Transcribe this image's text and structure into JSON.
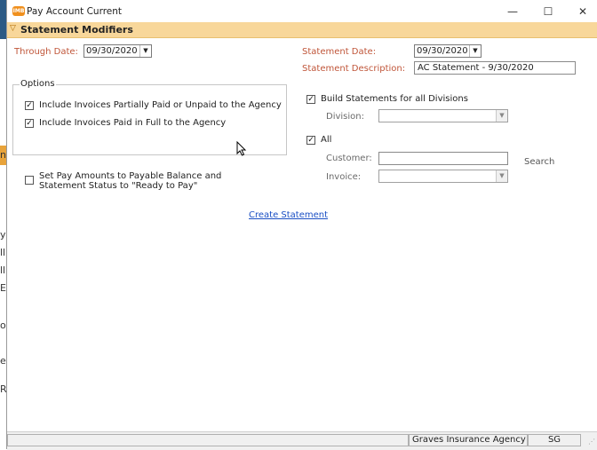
{
  "window": {
    "title": "Pay Account Current",
    "icon": "app-logo-icon",
    "icon_text": "IMB",
    "minimize_symbol": "—",
    "maximize_symbol": "☐",
    "close_symbol": "✕"
  },
  "section": {
    "title": "Statement Modifiers",
    "chevron": "▽"
  },
  "through_date": {
    "label": "Through Date:",
    "value": "09/30/2020",
    "dropdown": "▼"
  },
  "statement_date": {
    "label": "Statement Date:",
    "value": "09/30/2020",
    "dropdown": "▼"
  },
  "statement_description": {
    "label": "Statement Description:",
    "value": "AC Statement - 9/30/2020"
  },
  "options": {
    "legend": "Options",
    "partially_paid": {
      "label": "Include Invoices Partially Paid or Unpaid to the Agency",
      "checked": true
    },
    "paid_in_full": {
      "label": "Include Invoices Paid in Full to the Agency",
      "checked": true
    }
  },
  "set_pay_amounts": {
    "label_line1": "Set Pay Amounts to Payable Balance and",
    "label_line2": "Statement Status to \"Ready to Pay\"",
    "checked": false
  },
  "build_all_divisions": {
    "label": "Build Statements for all Divisions",
    "checked": true
  },
  "division": {
    "label": "Division:",
    "value": "",
    "dropdown": "▼"
  },
  "all": {
    "label": "All",
    "checked": true
  },
  "customer": {
    "label": "Customer:",
    "value": ""
  },
  "search": {
    "label": "Search"
  },
  "invoice": {
    "label": "Invoice:",
    "value": "",
    "dropdown": "▼"
  },
  "create_statement": {
    "label": "Create Statement"
  },
  "checkmark": "✓",
  "status_bar": {
    "agency": "Graves Insurance Agency",
    "user": "SG",
    "grip": "⋰"
  },
  "background_app": {
    "letters": [
      "y",
      "ll",
      "ll",
      "Ei",
      "n",
      "ou",
      "e",
      "R"
    ]
  },
  "colors": {
    "section_header": "#f8d79a",
    "label_orange": "#c0563a",
    "link": "#1a4fc4"
  }
}
